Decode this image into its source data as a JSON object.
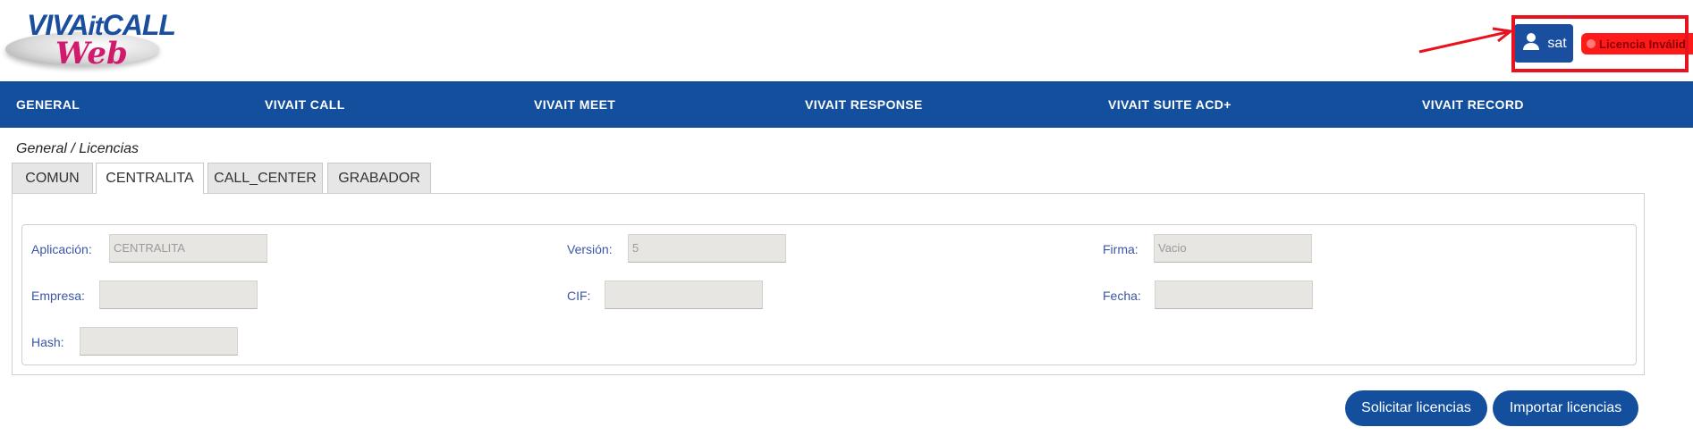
{
  "brand": {
    "logo_line1_a": "VIVA",
    "logo_line1_b": "it",
    "logo_line1_c": "CALL",
    "logo_line2": "Web"
  },
  "user": {
    "icon": "user-icon",
    "name": "sat"
  },
  "license_badge": {
    "text": "Licencia Inválid",
    "color": "#ff1a1a"
  },
  "nav": {
    "items": [
      {
        "label": "GENERAL"
      },
      {
        "label": "VIVAIT CALL"
      },
      {
        "label": "VIVAIT MEET"
      },
      {
        "label": "VIVAIT RESPONSE"
      },
      {
        "label": "VIVAIT SUITE ACD+"
      },
      {
        "label": "VIVAIT RECORD"
      }
    ]
  },
  "breadcrumb": "General / Licencias",
  "tabs": [
    {
      "label": "COMUN",
      "active": false
    },
    {
      "label": "CENTRALITA",
      "active": true
    },
    {
      "label": "CALL_CENTER",
      "active": false
    },
    {
      "label": "GRABADOR",
      "active": false
    }
  ],
  "form": {
    "aplicacion": {
      "label": "Aplicación:",
      "value": "CENTRALITA"
    },
    "version": {
      "label": "Versión:",
      "value": "5"
    },
    "firma": {
      "label": "Firma:",
      "value": "Vacio"
    },
    "empresa": {
      "label": "Empresa:",
      "value": ""
    },
    "cif": {
      "label": "CIF:",
      "value": ""
    },
    "fecha": {
      "label": "Fecha:",
      "value": ""
    },
    "hash": {
      "label": "Hash:",
      "value": ""
    }
  },
  "actions": {
    "request": "Solicitar licencias",
    "import": "Importar licencias"
  },
  "colors": {
    "primary": "#134f9c",
    "annotation": "#e8121e",
    "label": "#3a56a5"
  }
}
